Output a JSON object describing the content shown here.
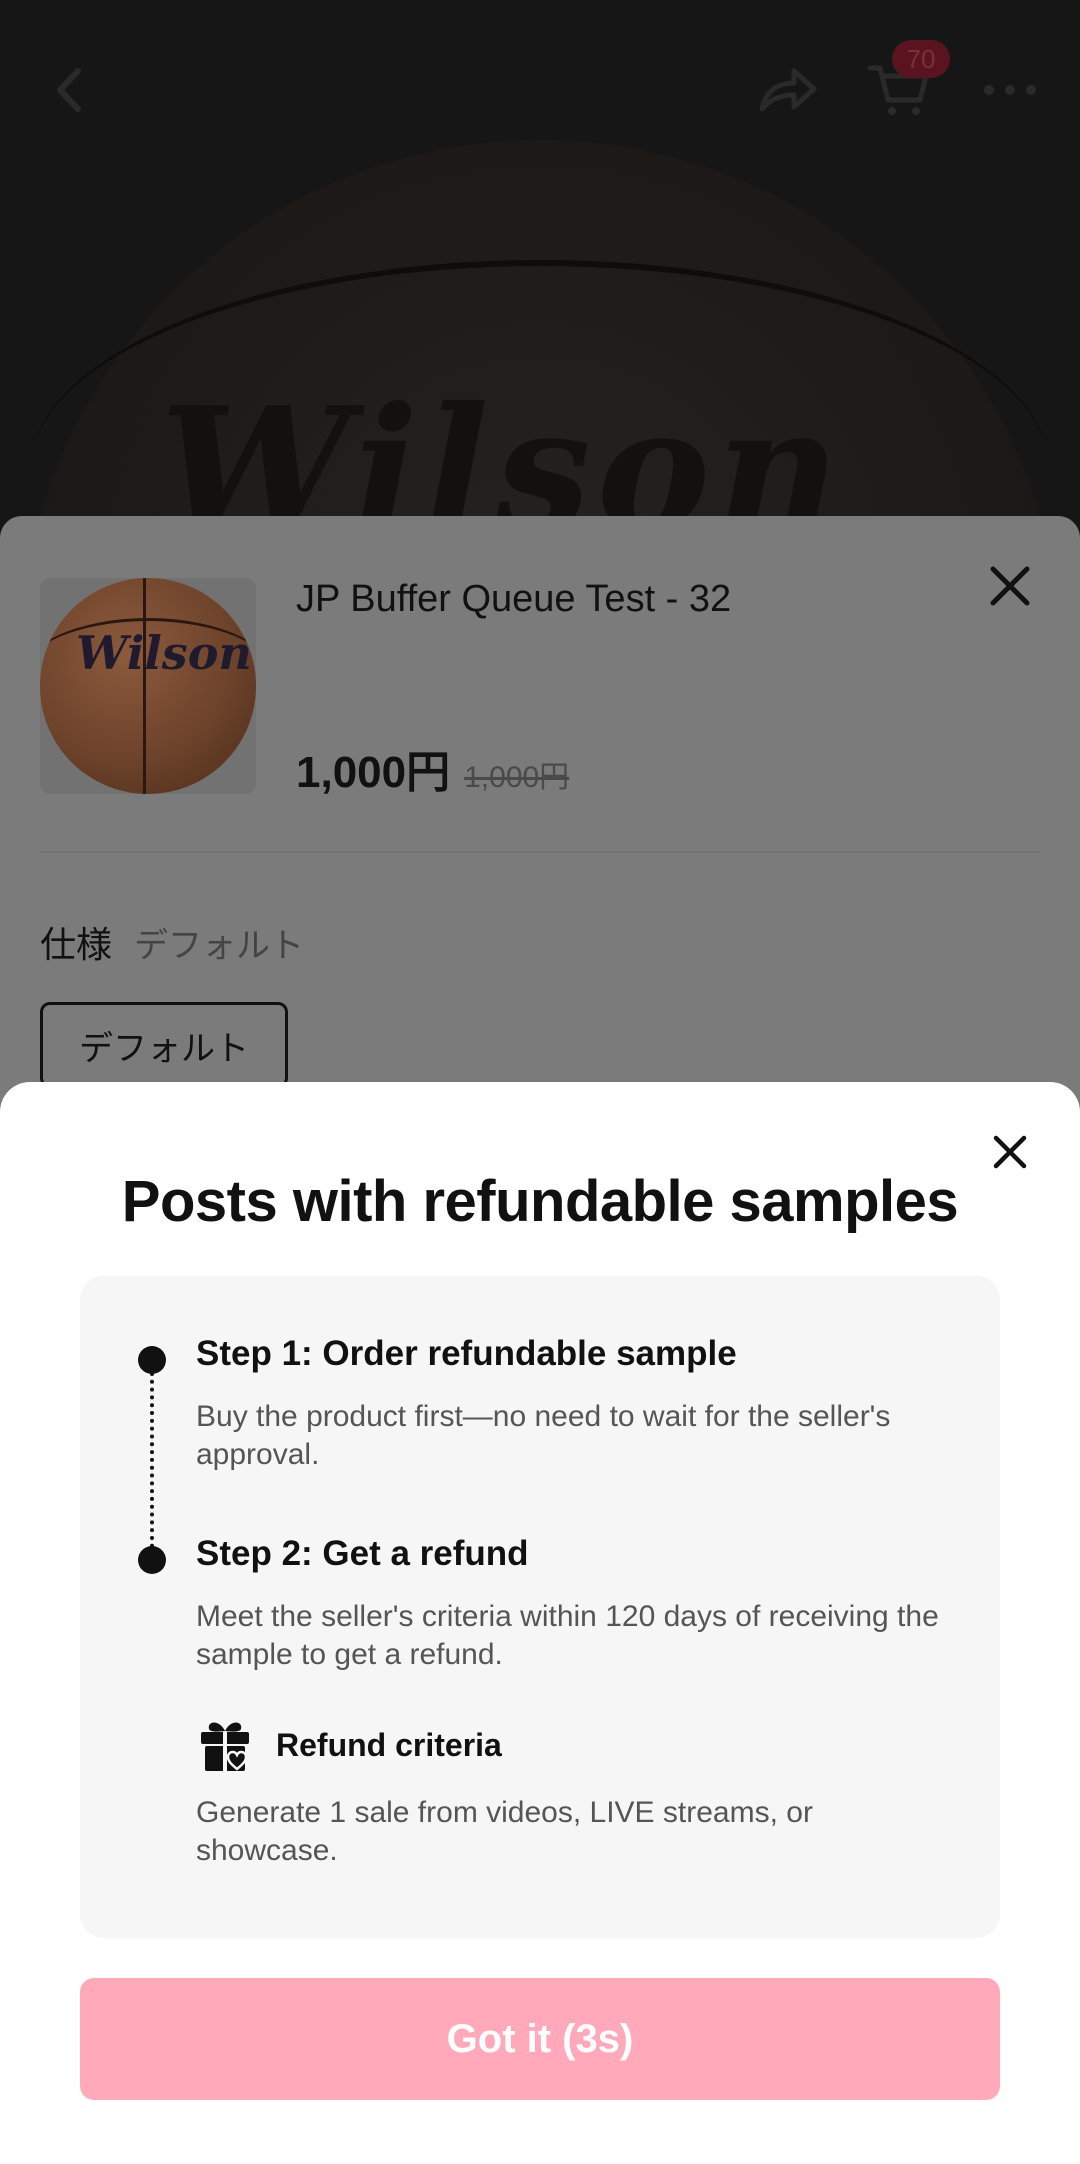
{
  "header": {
    "cart_badge": "70"
  },
  "product": {
    "image_brand_text": "Wilson",
    "title": "JP Buffer Queue Test - 32",
    "price": "1,000円",
    "original_price": "1,000円",
    "spec_label": "仕様",
    "spec_value": "デフォルト",
    "option_chip": "デフォルト"
  },
  "modal": {
    "title": "Posts with refundable samples",
    "steps": [
      {
        "title": "Step 1: Order refundable sample",
        "description": "Buy the product first—no need to wait for the seller's approval."
      },
      {
        "title": "Step 2: Get a refund",
        "description": "Meet the seller's criteria within 120 days of receiving the sample to get a refund."
      }
    ],
    "criteria": {
      "icon": "gift-icon",
      "title": "Refund criteria",
      "description": "Generate 1 sale from videos, LIVE streams, or showcase."
    },
    "button_label": "Got it (3s)"
  },
  "colors": {
    "button_bg": "#ffa9bb",
    "card_bg": "#f6f6f6",
    "overlay_sheet": "#7b7b7b"
  }
}
